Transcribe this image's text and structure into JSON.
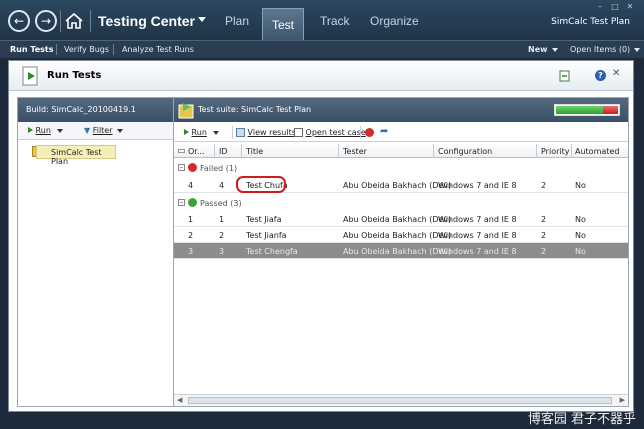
{
  "app": {
    "title": "Testing Center",
    "project": "SimCalc Test Plan",
    "tabs": [
      {
        "label": "Plan"
      },
      {
        "label": "Test"
      },
      {
        "label": "Track"
      },
      {
        "label": "Organize"
      }
    ],
    "selected_tab": "Test"
  },
  "subnav": {
    "items": [
      "Run Tests",
      "Verify Bugs",
      "Analyze Test Runs"
    ],
    "new_label": "New",
    "open_items": "Open Items (0)"
  },
  "page": {
    "title": "Run Tests"
  },
  "left_panel": {
    "build": "Build: SimCalc_20100419.1",
    "run_label": "Run",
    "filter_label": "Filter",
    "plan_item": "SimCalc Test Plan"
  },
  "right_panel": {
    "suite": "Test suite:  SimCalc Test Plan",
    "progress": {
      "passed": 0.75,
      "failed": 0.25,
      "passed_color": "#2d9f2d",
      "failed_color": "#c81f1f"
    },
    "toolbar": {
      "run": "Run",
      "view_results": "View results",
      "open_test_case": "Open test case"
    },
    "columns": [
      "Or...",
      "ID",
      "Title",
      "Tester",
      "Configuration",
      "Priority",
      "Automated"
    ],
    "groups": [
      {
        "label": "Failed (1)",
        "icon": "failed-icon",
        "rows": [
          {
            "order": "4",
            "id": "4",
            "title": "Test Chufa",
            "tester": "Abu Obeida Bakhach (Dev)",
            "config": "Windows 7 and IE 8",
            "priority": "2",
            "automated": "No"
          }
        ]
      },
      {
        "label": "Passed (3)",
        "icon": "passed-icon",
        "rows": [
          {
            "order": "1",
            "id": "1",
            "title": "Test Jiafa",
            "tester": "Abu Obeida Bakhach (Dev)",
            "config": "Windows 7 and IE 8",
            "priority": "2",
            "automated": "No"
          },
          {
            "order": "2",
            "id": "2",
            "title": "Test Jianfa",
            "tester": "Abu Obeida Bakhach (Dev)",
            "config": "Windows 7 and IE 8",
            "priority": "2",
            "automated": "No"
          },
          {
            "order": "3",
            "id": "3",
            "title": "Test Chengfa",
            "tester": "Abu Obeida Bakhach (Dev)",
            "config": "Windows 7 and IE 8",
            "priority": "2",
            "automated": "No"
          }
        ]
      }
    ]
  },
  "watermark": "博客园 君子不器乎"
}
